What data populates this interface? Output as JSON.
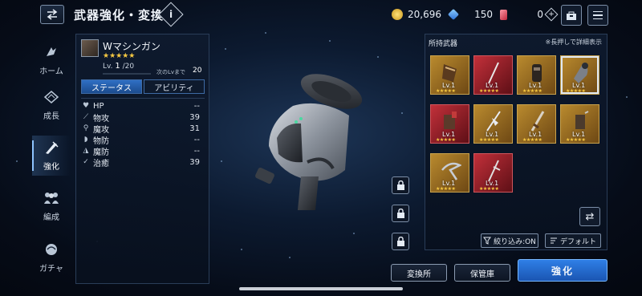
{
  "header": {
    "title": "武器強化・変換",
    "info_icon": "info-icon"
  },
  "currencies": {
    "gold": "20,696",
    "crystal": "150",
    "gem": "0"
  },
  "nav": [
    {
      "label": "ホーム",
      "icon": "home-icon"
    },
    {
      "label": "成長",
      "icon": "growth-icon"
    },
    {
      "label": "強化",
      "icon": "enhance-icon",
      "active": true
    },
    {
      "label": "編成",
      "icon": "party-icon"
    },
    {
      "label": "ガチャ",
      "icon": "gacha-icon"
    }
  ],
  "weapon": {
    "name": "Wマシンガン",
    "stars": "★★★★★",
    "level_label": "Lv.",
    "level": "1",
    "level_max": "/20",
    "next_label": "次のLvまで",
    "next_value": "20"
  },
  "tabs": {
    "status": "ステータス",
    "ability": "アビリティ"
  },
  "stats": [
    {
      "icon": "♥",
      "label": "HP",
      "value": "--"
    },
    {
      "icon": "⟋",
      "label": "物攻",
      "value": "39"
    },
    {
      "icon": "⚲",
      "label": "魔攻",
      "value": "31"
    },
    {
      "icon": "◗",
      "label": "物防",
      "value": "--"
    },
    {
      "icon": "◮",
      "label": "魔防",
      "value": "--"
    },
    {
      "icon": "✓",
      "label": "治癒",
      "value": "39"
    }
  ],
  "inventory": {
    "title": "所持武器",
    "hint": "※長押しで詳細表示",
    "items": [
      {
        "lv": "Lv.1",
        "stars": "★★★★★",
        "rarity": "gold"
      },
      {
        "lv": "Lv.1",
        "stars": "★★★★★",
        "rarity": "red"
      },
      {
        "lv": "Lv.1",
        "stars": "★★★★★",
        "rarity": "gold"
      },
      {
        "lv": "Lv.1",
        "stars": "★★★★★",
        "rarity": "gold"
      },
      {
        "lv": "Lv.1",
        "stars": "★★★★★",
        "rarity": "gold"
      },
      {
        "lv": "Lv.1",
        "stars": "★★★★★",
        "rarity": "gold"
      },
      {
        "lv": "Lv.1",
        "stars": "★★★★★",
        "rarity": "gold"
      },
      {
        "lv": "Lv.1",
        "stars": "★★★★★",
        "rarity": "gold"
      },
      {
        "lv": "Lv.1",
        "stars": "★★★★★",
        "rarity": "gold"
      },
      {
        "lv": "Lv.1",
        "stars": "★★★★★",
        "rarity": "red"
      }
    ],
    "filter_label": "絞り込み:ON",
    "default_label": "デフォルト"
  },
  "buttons": {
    "exchange": "変換所",
    "storage": "保管庫",
    "enhance": "強化"
  },
  "colors": {
    "accent": "#2f7fe6",
    "gold_frame": "#c9a24c",
    "red_frame": "#c2303a",
    "star": "#f5c842"
  }
}
